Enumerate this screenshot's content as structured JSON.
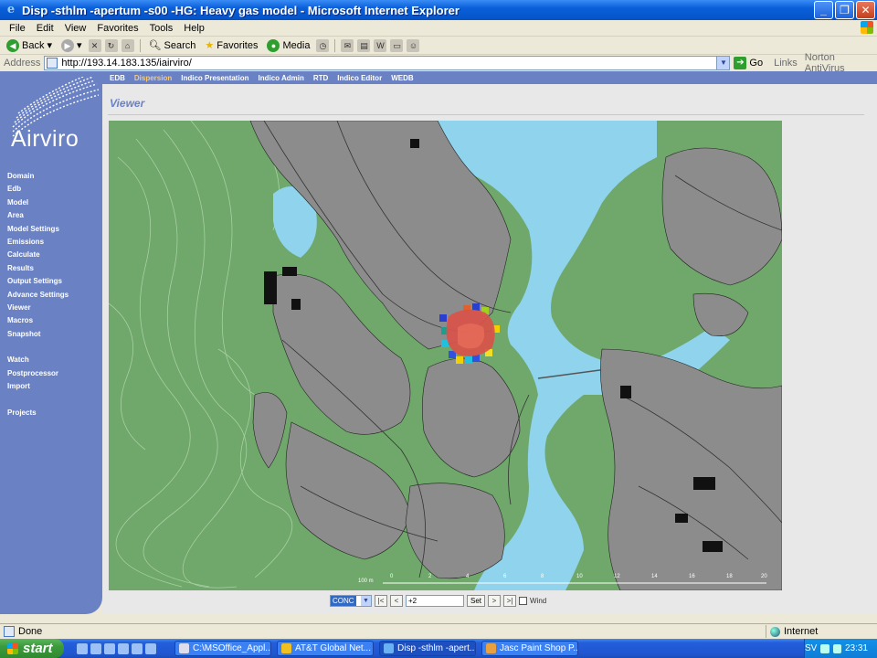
{
  "window": {
    "title": "Disp -sthlm -apertum -s00 -HG: Heavy gas model - Microsoft Internet Explorer",
    "minimize": "_",
    "maximize": "❐",
    "close": "✕"
  },
  "menubar": [
    "File",
    "Edit",
    "View",
    "Favorites",
    "Tools",
    "Help"
  ],
  "toolbar": {
    "back": "Back",
    "search": "Search",
    "favorites": "Favorites",
    "media": "Media"
  },
  "addressbar": {
    "label": "Address",
    "url": "http://193.14.183.135/iairviro/",
    "go": "Go",
    "links": "Links",
    "norton": "Norton AntiVirus"
  },
  "app": {
    "logo_text": "Airviro",
    "topnav": [
      {
        "label": "EDB",
        "active": false
      },
      {
        "label": "Dispersion",
        "active": true
      },
      {
        "label": "Indico Presentation",
        "active": false
      },
      {
        "label": "Indico Admin",
        "active": false
      },
      {
        "label": "RTD",
        "active": false
      },
      {
        "label": "Indico Editor",
        "active": false
      },
      {
        "label": "WEDB",
        "active": false
      }
    ],
    "sidebar_group1": [
      "Domain",
      "Edb",
      "Model",
      "Area",
      "Model Settings",
      "Emissions",
      "Calculate",
      "Results",
      "Output Settings",
      "Advance Settings",
      "Viewer",
      "Macros",
      "Snapshot"
    ],
    "sidebar_group2": [
      "Watch",
      "Postprocessor",
      "Import"
    ],
    "sidebar_group3": [
      "Projects"
    ],
    "page_title": "Viewer"
  },
  "map": {
    "scale_label": "100 m",
    "scale_ticks": [
      "0",
      "2",
      "4",
      "6",
      "8",
      "10",
      "12",
      "14",
      "16",
      "18",
      "20"
    ],
    "colors": {
      "land": "#6fa86a",
      "water": "#8fd3ec",
      "buildings": "#8c8c8c",
      "plume_core": "#d9534a"
    }
  },
  "controls": {
    "variable": "CONC",
    "first": "|<",
    "prev": "<",
    "step_value": "+2",
    "set": "Set",
    "next": ">",
    "last": ">|",
    "wind_label": "Wind"
  },
  "statusbar": {
    "status": "Done",
    "zone": "Internet"
  },
  "taskbar": {
    "start": "start",
    "tasks": [
      {
        "label": "C:\\MSOffice_Appl...",
        "active": false
      },
      {
        "label": "AT&T Global Net...",
        "active": false
      },
      {
        "label": "Disp -sthlm -apert...",
        "active": true
      },
      {
        "label": "Jasc Paint Shop P...",
        "active": false
      }
    ],
    "lang": "SV",
    "clock": "23:31"
  }
}
